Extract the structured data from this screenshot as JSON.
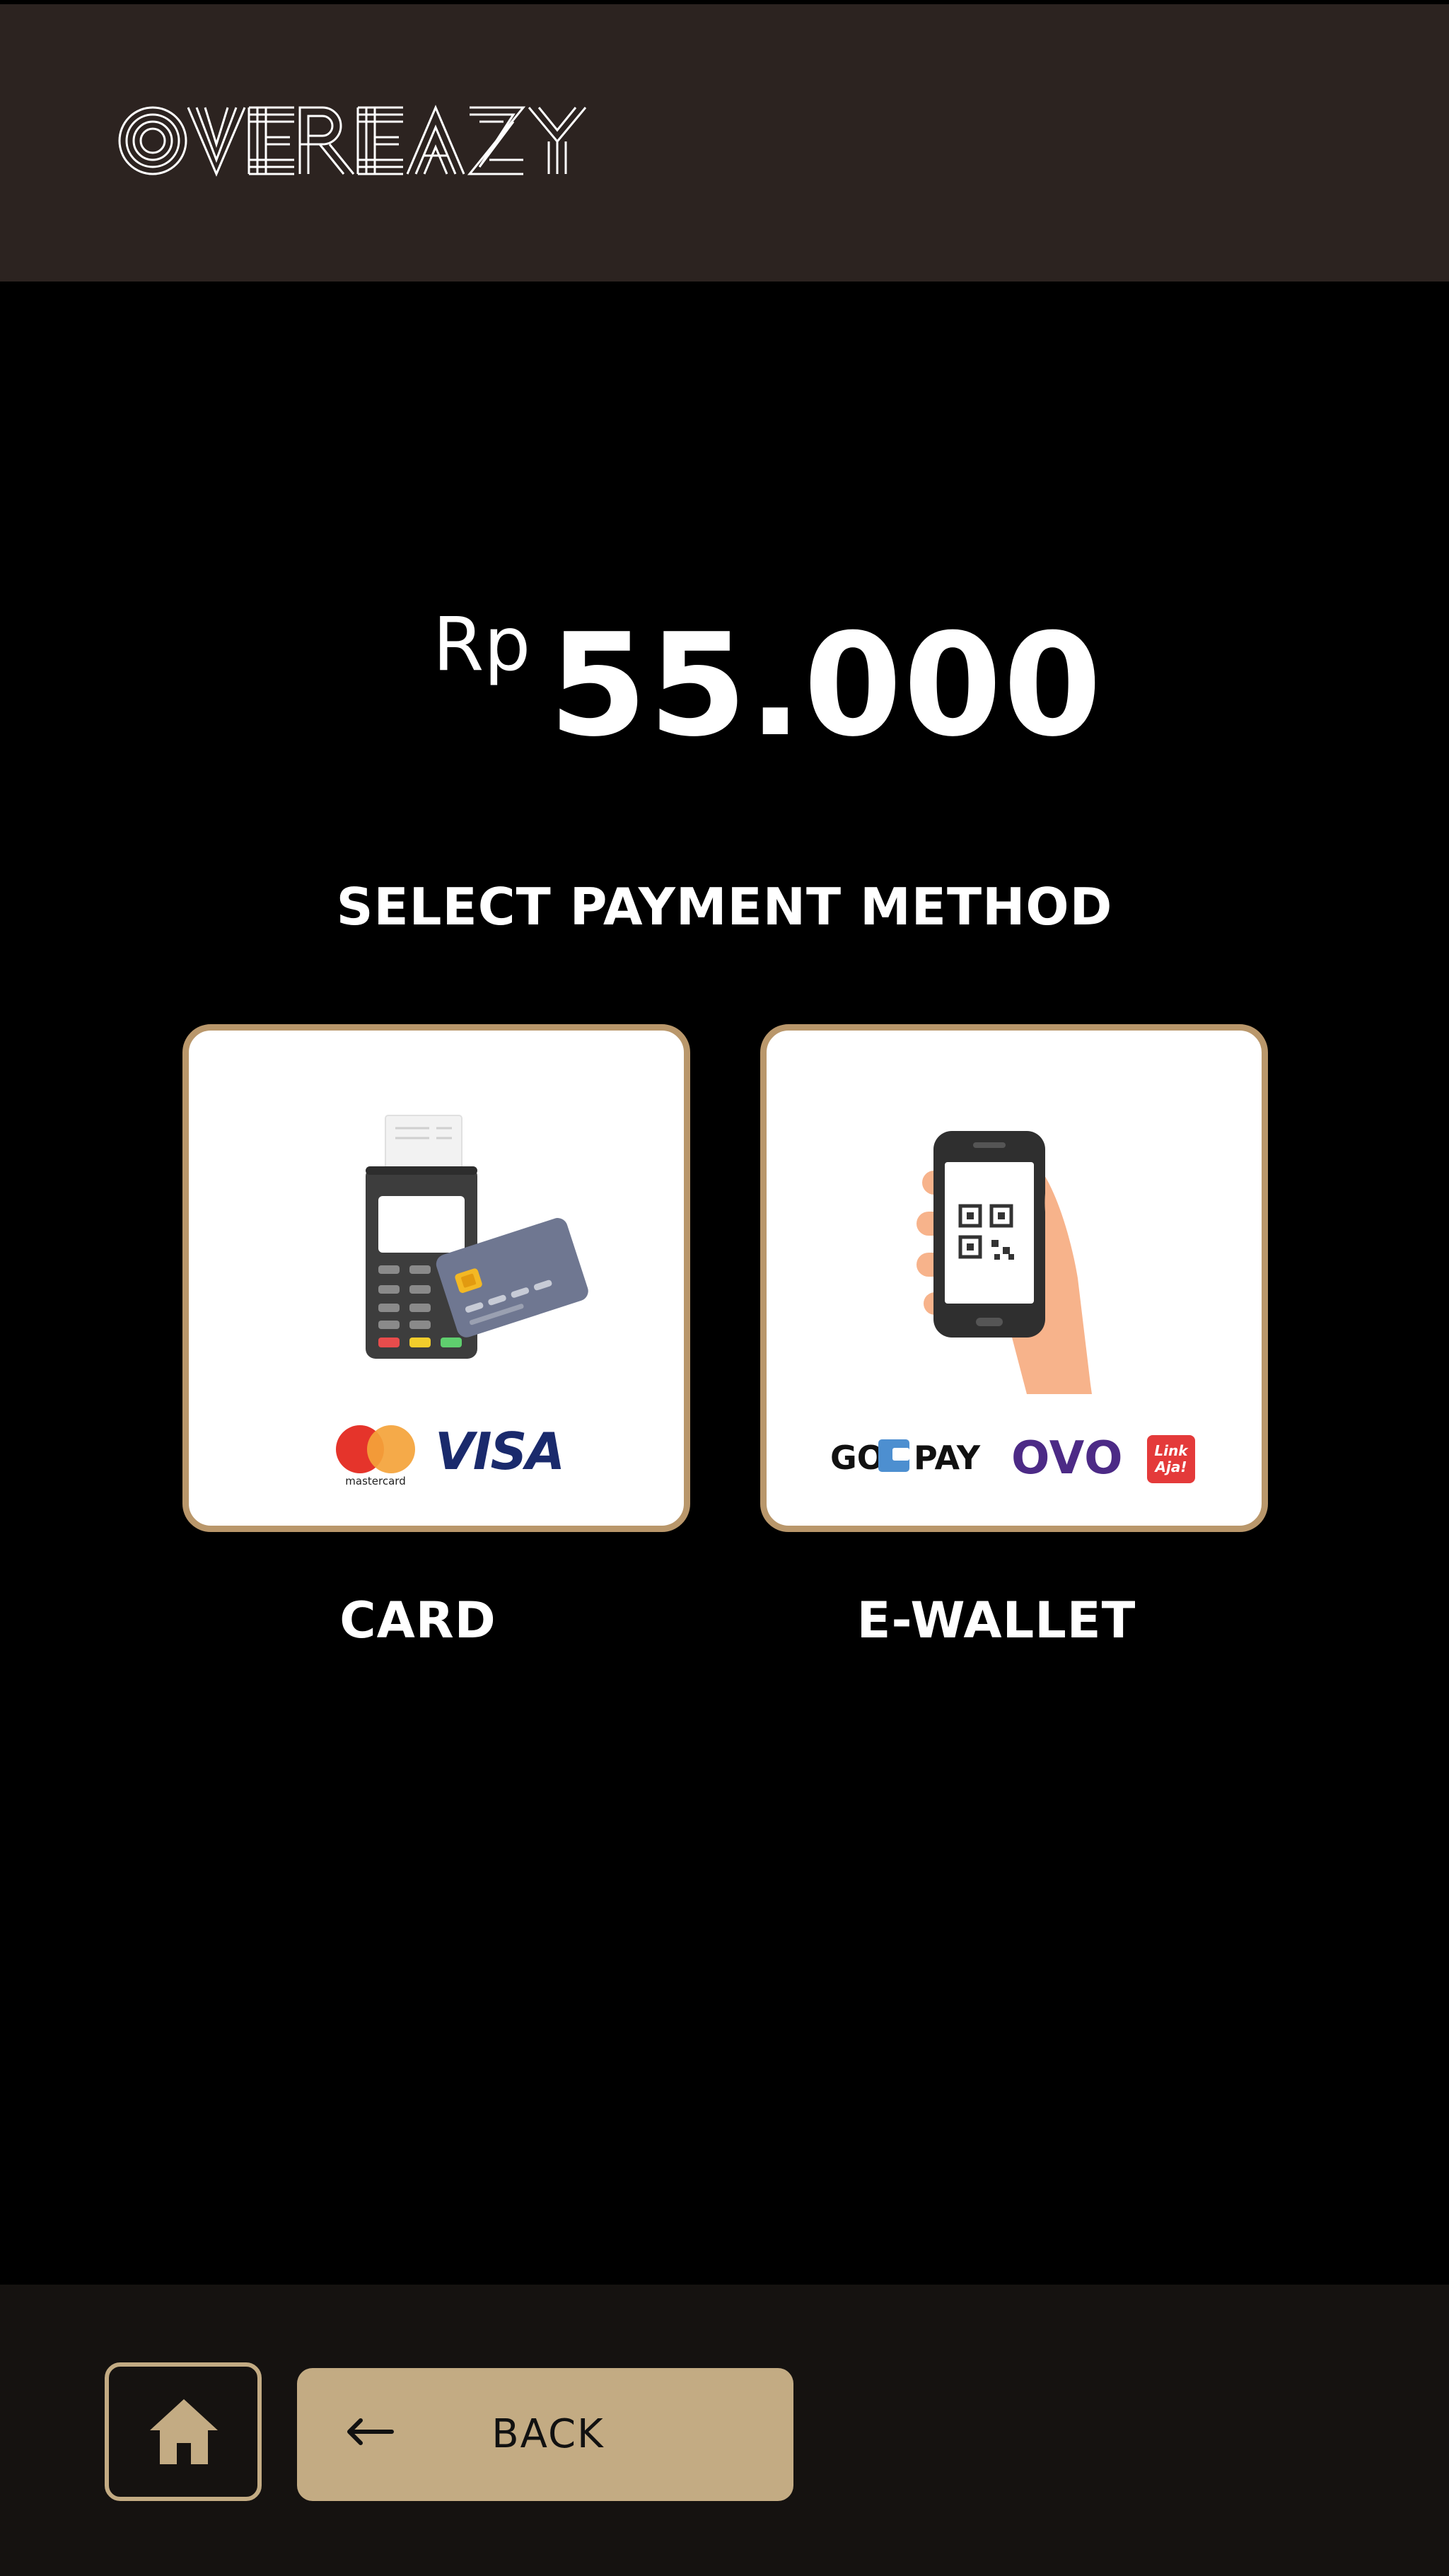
{
  "header": {
    "brand_name": "OVEREAZY",
    "background_color": "#2c2320"
  },
  "price": {
    "currency": "Rp",
    "amount": "55.000"
  },
  "select_title": "SELECT PAYMENT METHOD",
  "payment_methods": [
    {
      "label": "CARD",
      "illustration_icon": "card-terminal-icon",
      "logos": [
        "mastercard",
        "VISA"
      ],
      "mastercard_text": "mastercard",
      "visa_text": "VISA"
    },
    {
      "label": "E-WALLET",
      "illustration_icon": "phone-qr-icon",
      "logos": [
        "GOPAY",
        "OVO",
        "LinkAja!"
      ],
      "gopay_left": "GO",
      "gopay_right": "PAY",
      "ovo_text": "OVO",
      "linkaja_line1": "Link",
      "linkaja_line2": "Aja!"
    }
  ],
  "footer": {
    "home_icon": "home-icon",
    "back_label": "BACK",
    "back_icon": "arrow-left-icon"
  },
  "colors": {
    "accent": "#c3ab83",
    "card_border": "#b9976b",
    "background": "#000000",
    "footer": "#151210"
  }
}
